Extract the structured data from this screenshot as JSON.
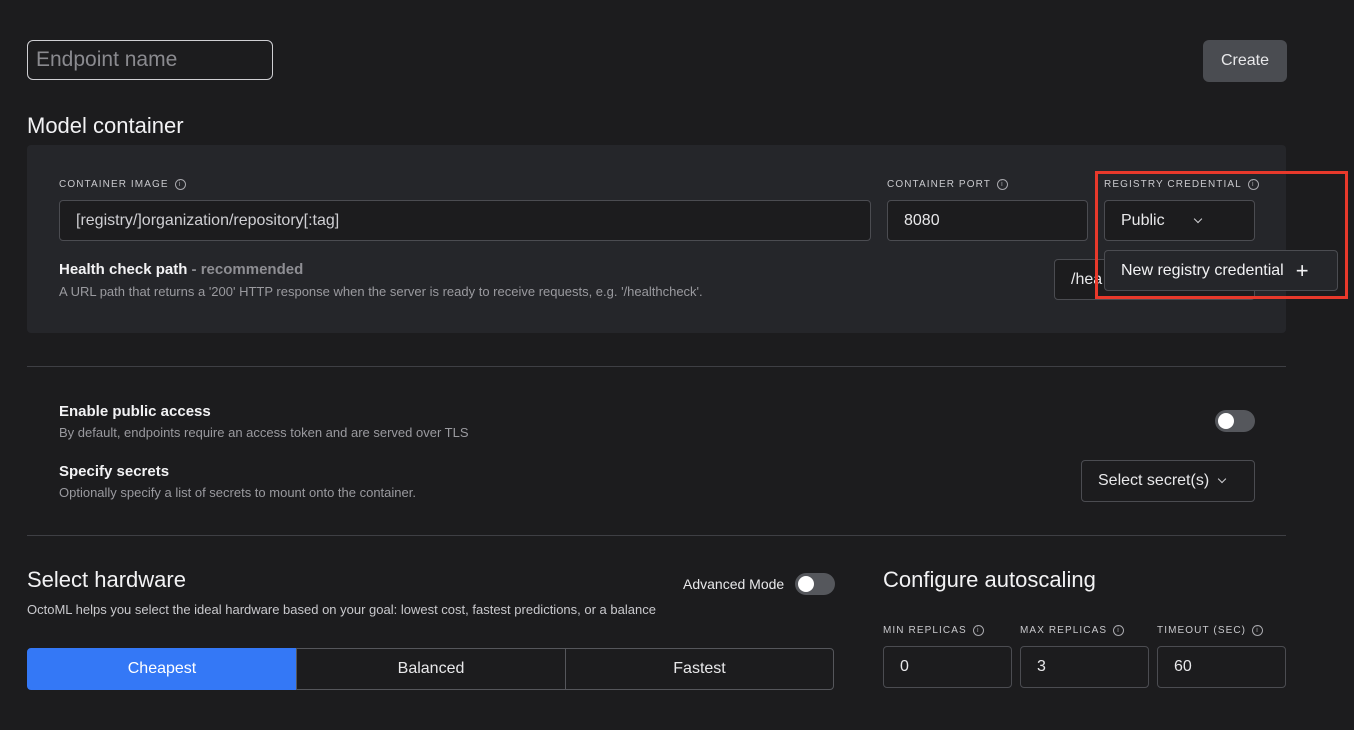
{
  "header": {
    "endpoint_name_placeholder": "Endpoint name",
    "create_label": "Create"
  },
  "model_container": {
    "title": "Model container",
    "container_image_caption": "CONTAINER IMAGE",
    "container_image_placeholder": "[registry/]organization/repository[:tag]",
    "container_port_caption": "CONTAINER PORT",
    "container_port_value": "8080",
    "registry_credential_caption": "REGISTRY CREDENTIAL",
    "registry_credential_value": "Public",
    "health_check_title": "Health check path",
    "health_check_suffix": " - recommended",
    "health_check_desc": "A URL path that returns a '200' HTTP response when the server is ready to receive requests, e.g. '/healthcheck'.",
    "health_check_value": "/hea",
    "dropdown_option": "New registry credential"
  },
  "access": {
    "public_title": "Enable public access",
    "public_desc": "By default, endpoints require an access token and are served over TLS",
    "secrets_title": "Specify secrets",
    "secrets_desc": "Optionally specify a list of secrets to mount onto the container.",
    "secrets_select": "Select secret(s)"
  },
  "hardware": {
    "title": "Select hardware",
    "advanced_mode_label": "Advanced Mode",
    "desc": "OctoML helps you select the ideal hardware based on your goal: lowest cost, fastest predictions, or a balance",
    "options": [
      "Cheapest",
      "Balanced",
      "Fastest"
    ],
    "selected": "Cheapest"
  },
  "autoscaling": {
    "title": "Configure autoscaling",
    "min_caption": "MIN REPLICAS",
    "min_value": "0",
    "max_caption": "MAX REPLICAS",
    "max_value": "3",
    "timeout_caption": "TIMEOUT (SEC)",
    "timeout_value": "60"
  },
  "colors": {
    "accent": "#3478f6",
    "highlight": "#e8392b",
    "background": "#1c1c1e"
  }
}
